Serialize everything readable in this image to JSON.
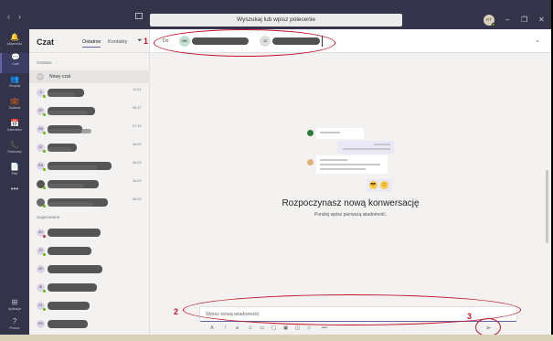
{
  "titlebar": {
    "back": "‹",
    "forward": "›",
    "search_placeholder": "Wyszukaj lub wpisz polecenie",
    "avatar_initials": "KT",
    "minimize": "–",
    "maximize": "❐",
    "close": "✕"
  },
  "rail": {
    "items": [
      {
        "label": "Aktywność",
        "icon": "🔔"
      },
      {
        "label": "Czat",
        "icon": "💬"
      },
      {
        "label": "Zespoły",
        "icon": "👥"
      },
      {
        "label": "Zadania",
        "icon": "💼"
      },
      {
        "label": "Kalendarz",
        "icon": "📅"
      },
      {
        "label": "Rozmowy",
        "icon": "📞"
      },
      {
        "label": "Pliki",
        "icon": "📄"
      },
      {
        "label": "",
        "icon": "•••"
      },
      {
        "label": "Aplikacje",
        "icon": "⊞"
      },
      {
        "label": "Pomoc",
        "icon": "?"
      }
    ]
  },
  "chatlist": {
    "title": "Czat",
    "tabs": [
      "Ostatnie",
      "Kontakty"
    ],
    "section_recent": "Ostatnie",
    "new_chat": "Nowy czat",
    "recent": [
      {
        "initials": "A",
        "time": "10:24"
      },
      {
        "initials": "SP",
        "time": "08:37"
      },
      {
        "initials": "ZM",
        "time": "07:23"
      },
      {
        "initials": "JZ",
        "time": "16.03"
      },
      {
        "initials": "PM",
        "time": "16.03"
      },
      {
        "initials": "",
        "time": "16.03"
      },
      {
        "initials": "",
        "time": "16.03"
      }
    ],
    "section_suggested": "Sugerowane",
    "suggested": [
      {
        "initials": "AH"
      },
      {
        "initials": "JS"
      },
      {
        "initials": "AR"
      },
      {
        "initials": "BI"
      },
      {
        "initials": "DL"
      },
      {
        "initials": "MO"
      }
    ]
  },
  "main": {
    "to_label": "Do:",
    "recipients": [
      {
        "initials": "BB"
      },
      {
        "initials": "JZ"
      }
    ],
    "headline": "Rozpoczynasz nową konwersację",
    "subline": "Poniżej wpisz pierwszą wiadomość.",
    "compose_placeholder": "Wpisz nową wiadomość",
    "send_icon": "send-icon"
  },
  "annotations": {
    "n1": "1",
    "n2": "2",
    "n3": "3",
    "color": "#c0142b"
  }
}
